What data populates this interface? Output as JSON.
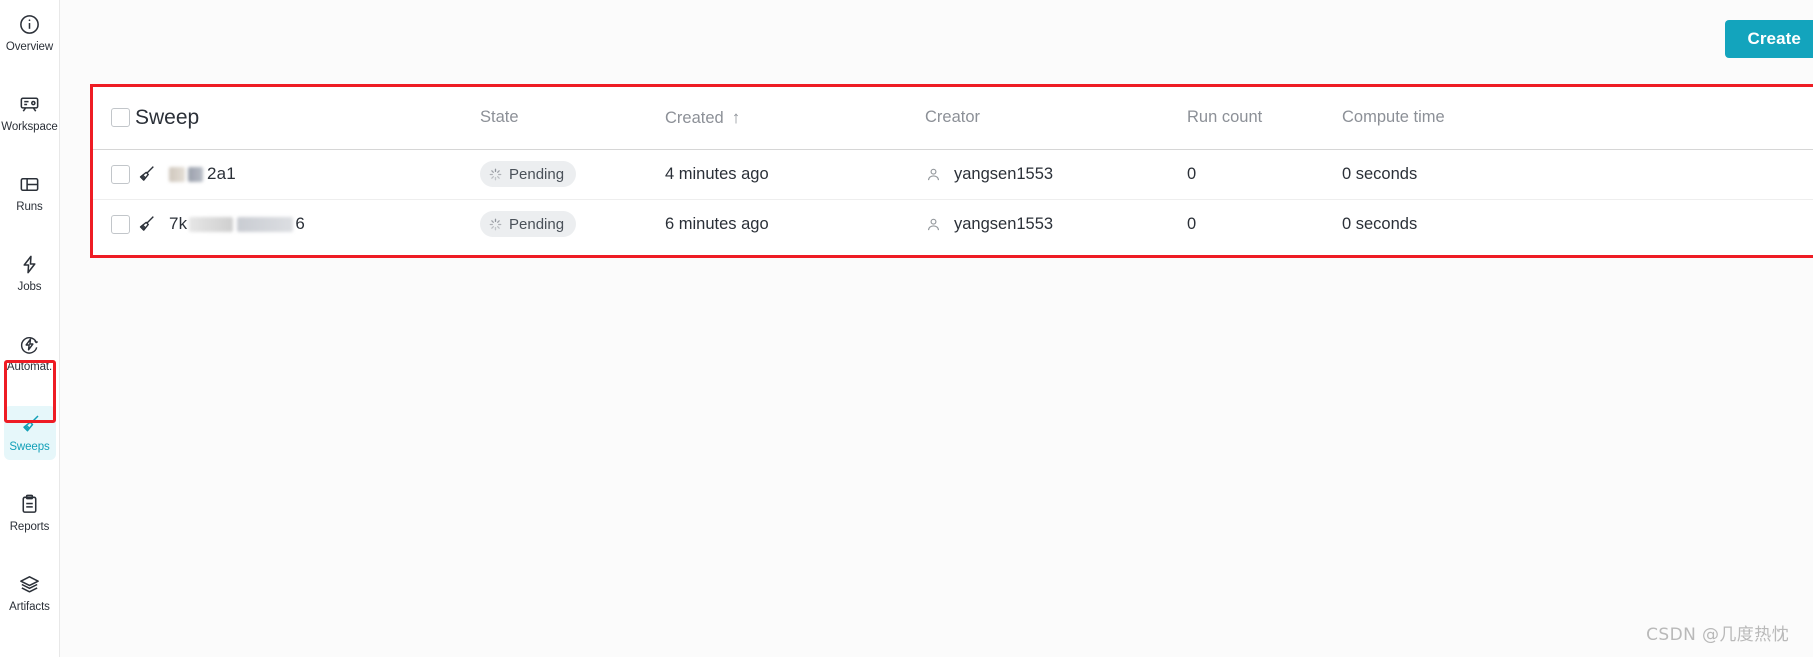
{
  "sidebar": {
    "items": [
      {
        "label": "Overview",
        "icon": "info-circle-icon",
        "active": false
      },
      {
        "label": "Workspace",
        "icon": "workspace-icon",
        "active": false
      },
      {
        "label": "Runs",
        "icon": "runs-table-icon",
        "active": false
      },
      {
        "label": "Jobs",
        "icon": "bolt-icon",
        "active": false
      },
      {
        "label": "Automat.",
        "icon": "automation-icon",
        "active": false
      },
      {
        "label": "Sweeps",
        "icon": "broom-icon",
        "active": true
      },
      {
        "label": "Reports",
        "icon": "clipboard-icon",
        "active": false
      },
      {
        "label": "Artifacts",
        "icon": "layers-icon",
        "active": false
      }
    ],
    "active_highlight_color": "#ee1c24",
    "active_color": "#12a0b8"
  },
  "toolbar": {
    "create_label": "Create",
    "create_color": "#13a4bd"
  },
  "table": {
    "highlight_color": "#ee1c24",
    "headers": {
      "sweep": "Sweep",
      "state": "State",
      "created": "Created",
      "created_sort": "↑",
      "creator": "Creator",
      "run_count": "Run count",
      "compute_time": "Compute time"
    },
    "rows": [
      {
        "name_suffix": "2a1",
        "name_prefix_redacted": true,
        "state": "Pending",
        "created": "4 minutes ago",
        "creator": "yangsen1553",
        "run_count": "0",
        "compute_time": "0 seconds"
      },
      {
        "name_prefix": "7k",
        "name_suffix": "6",
        "name_prefix_redacted": true,
        "state": "Pending",
        "created": "6 minutes ago",
        "creator": "yangsen1553",
        "run_count": "0",
        "compute_time": "0 seconds"
      }
    ]
  },
  "watermark": {
    "text": "CSDN @几度热忱"
  }
}
